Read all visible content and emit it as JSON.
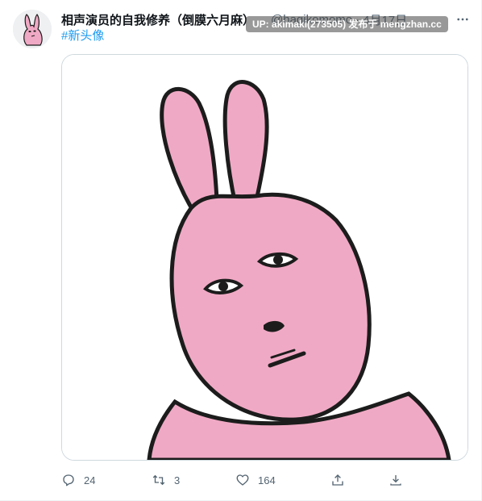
{
  "tweet": {
    "display_name": "相声演员的自我修养（倒膜六月麻）",
    "handle": "@hagikomomo",
    "separator": "·",
    "timestamp": "4月17日",
    "watermark": "UP: akimaki(273505) 发布于 mengzhan.cc",
    "hashtag": "#新头像",
    "media_alt": "pink rabbit cartoon"
  },
  "actions": {
    "reply_count": "24",
    "retweet_count": "3",
    "like_count": "164"
  },
  "icons": {
    "more": "more-icon",
    "reply": "reply-icon",
    "retweet": "retweet-icon",
    "like": "like-icon",
    "share": "share-icon",
    "download": "download-icon"
  },
  "colors": {
    "link": "#1d9bf0",
    "text_secondary": "#536471",
    "rabbit_pink": "#f0a9c4",
    "outline": "#1c1c1c"
  }
}
